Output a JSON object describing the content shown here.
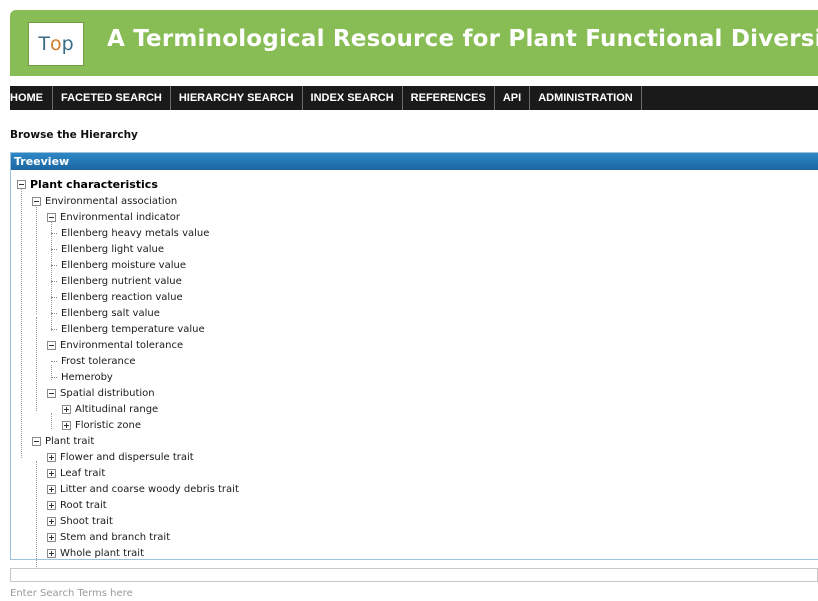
{
  "logo": {
    "left": "T",
    "o": "o",
    "right": "p"
  },
  "site_title": "A Terminological Resource for Plant Functional Diversity",
  "nav": [
    "HOME",
    "FACETED SEARCH",
    "HIERARCHY SEARCH",
    "INDEX SEARCH",
    "REFERENCES",
    "API",
    "ADMINISTRATION"
  ],
  "section_heading": "Browse the Hierarchy",
  "tree_header": "Treeview",
  "tree": {
    "root": "Plant characteristics",
    "environmental_association": "Environmental association",
    "environmental_indicator": "Environmental indicator",
    "indicators": [
      "Ellenberg heavy metals value",
      "Ellenberg light value",
      "Ellenberg moisture value",
      "Ellenberg nutrient value",
      "Ellenberg reaction value",
      "Ellenberg salt value",
      "Ellenberg temperature value"
    ],
    "environmental_tolerance": "Environmental tolerance",
    "tolerances": [
      "Frost tolerance",
      "Hemeroby"
    ],
    "spatial_distribution": "Spatial distribution",
    "spatial_items": [
      "Altitudinal range",
      "Floristic zone"
    ],
    "plant_trait": "Plant trait",
    "traits": [
      "Flower and dispersule trait",
      "Leaf trait",
      "Litter and coarse woody debris trait",
      "Root trait",
      "Shoot trait",
      "Stem and branch trait",
      "Whole plant trait"
    ]
  },
  "search": {
    "hint": "Enter Search Terms here"
  }
}
